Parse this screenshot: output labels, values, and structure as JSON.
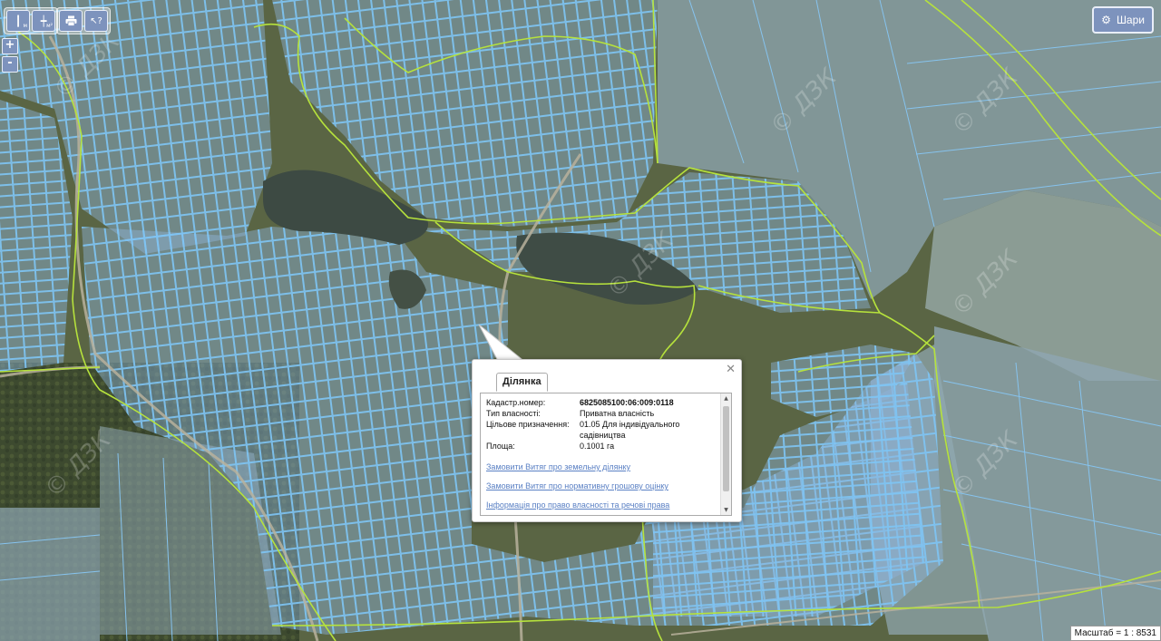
{
  "toolbar": {
    "measure_length_icon": "ruler-m-icon",
    "measure_length_sub": "м",
    "measure_area_icon": "ruler-area-icon",
    "measure_area_sub": "м²",
    "print_icon": "print-icon",
    "identify_icon": "identify-question-icon"
  },
  "zoom": {
    "in_label": "+",
    "out_label": "-"
  },
  "layers_button": {
    "label": "Шари",
    "icon": "gear-icon"
  },
  "popup": {
    "tab_label": "Ділянка",
    "fields": [
      {
        "key": "Кадастр.номер:",
        "value": "6825085100:06:009:0118",
        "bold": true
      },
      {
        "key": "Тип власності:",
        "value": "Приватна власність",
        "bold": false
      },
      {
        "key": "Цільове призначення:",
        "value": "01.05 Для індивідуального садівництва",
        "bold": false
      },
      {
        "key": "Площа:",
        "value": "0.1001 га",
        "bold": false
      }
    ],
    "links": [
      "Замовити Витяг про земельну ділянку",
      "Замовити Витяг про нормативну грошову оцінку",
      "Інформація про право власності та речові права"
    ]
  },
  "watermark": "© ДЗК",
  "scale_label": "Масштаб = 1 : 8531",
  "colors": {
    "parcel_fill": "#8fb4d9",
    "parcel_stroke": "#7ec4f4",
    "boundary": "#b6e23c",
    "water": "#3d4a43",
    "button": "#7d93bd"
  }
}
